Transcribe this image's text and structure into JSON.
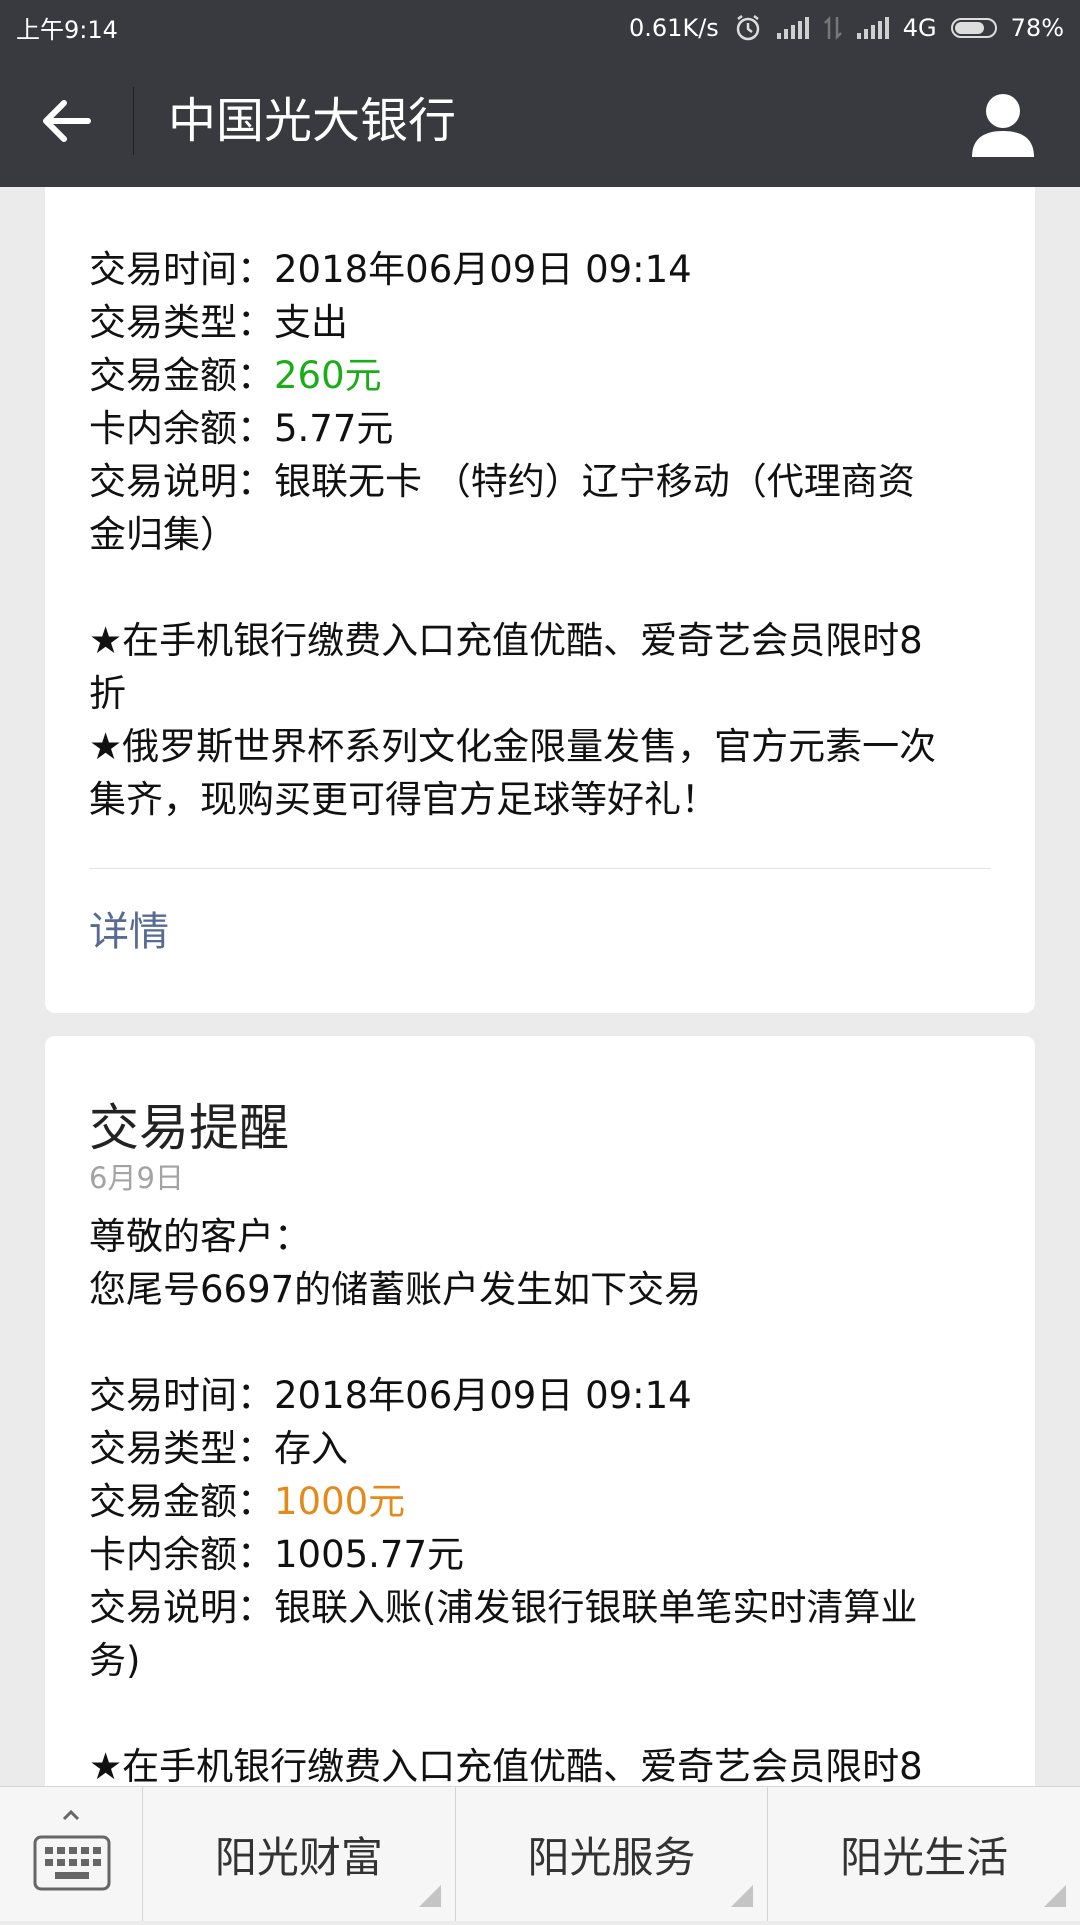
{
  "status_bar": {
    "time": "上午9:14",
    "net_speed": "0.61K/s",
    "network_type": "4G",
    "battery": "78%"
  },
  "header": {
    "title": "中国光大银行"
  },
  "card1": {
    "tx_time_label": "交易时间：",
    "tx_time_value": "2018年06月09日  09:14",
    "tx_type_label": "交易类型：",
    "tx_type_value": "支出",
    "tx_amount_label": "交易金额：",
    "tx_amount_value": "260元",
    "balance_label": "卡内余额：",
    "balance_value": "5.77元",
    "desc_label": "交易说明：",
    "desc_value_line1": "银联无卡 （特约）辽宁移动（代理商资",
    "desc_value_line2": "金归集）",
    "promo1_line1": "★在手机银行缴费入口充值优酷、爱奇艺会员限时8",
    "promo1_line2": "折",
    "promo2_line1": "★俄罗斯世界杯系列文化金限量发售，官方元素一次",
    "promo2_line2": "集齐，现购买更可得官方足球等好礼！",
    "detail_link": "详情"
  },
  "card2": {
    "title": "交易提醒",
    "date": "6月9日",
    "greeting": "尊敬的客户：",
    "intro": "您尾号6697的储蓄账户发生如下交易",
    "tx_time_label": "交易时间：",
    "tx_time_value": "2018年06月09日  09:14",
    "tx_type_label": "交易类型：",
    "tx_type_value": "存入",
    "tx_amount_label": "交易金额：",
    "tx_amount_value": "1000元",
    "balance_label": "卡内余额：",
    "balance_value": "1005.77元",
    "desc_label": "交易说明：",
    "desc_value_line1": "银联入账(浦发银行银联单笔实时清算业",
    "desc_value_line2": "务)",
    "promo1_partial": "★在手机银行缴费入口充值优酷、爱奇艺会员限时8"
  },
  "bottom_menu": {
    "items": [
      "阳光财富",
      "阳光服务",
      "阳光生活"
    ]
  },
  "colors": {
    "expense": "#1aad19",
    "income": "#e58a18",
    "link": "#576b95",
    "bar": "#393a3f"
  }
}
